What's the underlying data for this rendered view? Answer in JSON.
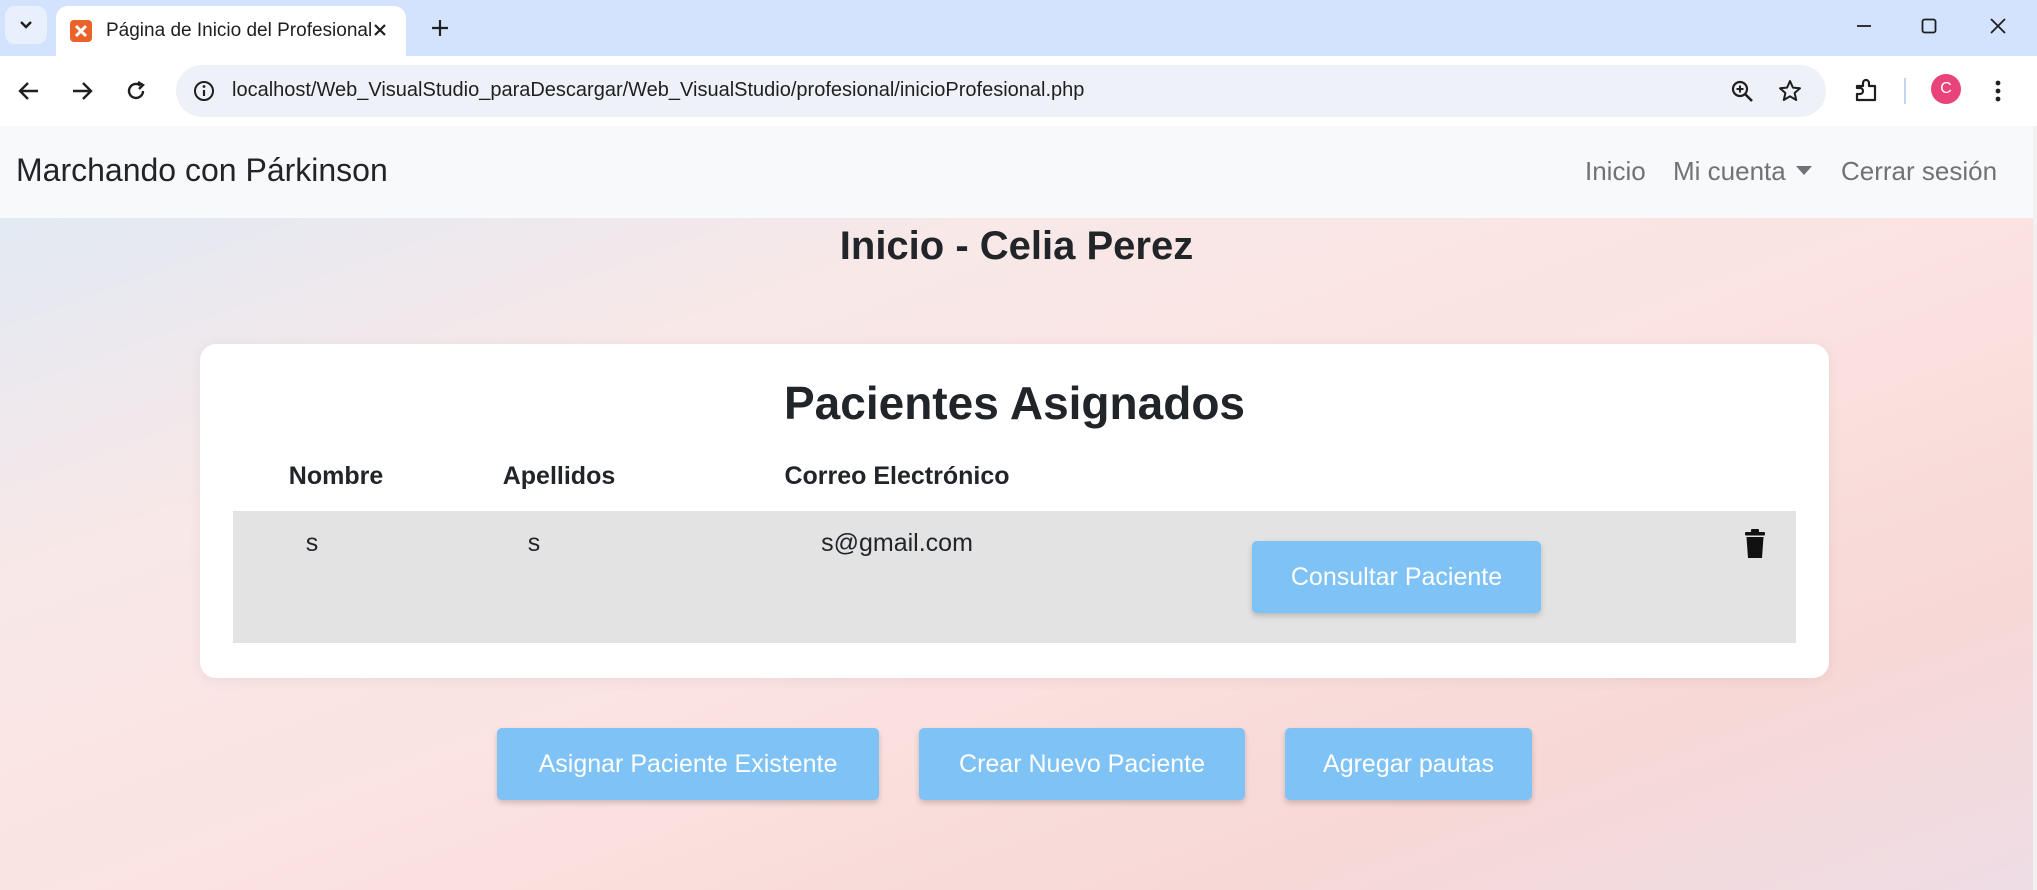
{
  "browser": {
    "tab": {
      "title": "Página de Inicio del Profesional"
    },
    "url": "localhost/Web_VisualStudio_paraDescargar/Web_VisualStudio/profesional/inicioProfesional.php",
    "profile_initial": "C",
    "icons": [
      "tab-list-icon",
      "favicon-icon",
      "close-icon",
      "plus-icon",
      "minimize-icon",
      "maximize-icon",
      "close-window-icon",
      "back-icon",
      "forward-icon",
      "reload-icon",
      "site-info-icon",
      "zoom-icon",
      "star-icon",
      "extensions-icon",
      "kebab-menu-icon"
    ]
  },
  "navbar": {
    "brand": "Marchando con Párkinson",
    "links": {
      "inicio": "Inicio",
      "mi_cuenta": "Mi cuenta",
      "cerrar_sesion": "Cerrar sesión"
    }
  },
  "page": {
    "title": "Inicio - Celia Perez"
  },
  "patients": {
    "title": "Pacientes Asignados",
    "columns": [
      "Nombre",
      "Apellidos",
      "Correo Electrónico"
    ],
    "rows": [
      {
        "nombre": "s",
        "apellidos": "s",
        "correo": "s@gmail.com",
        "action": "Consultar Paciente"
      }
    ]
  },
  "actions": {
    "assign": "Asignar Paciente Existente",
    "create": "Crear Nuevo Paciente",
    "guidelines": "Agregar pautas"
  },
  "colors": {
    "button": "#7fc2f5",
    "tabstrip": "#d3e3fd",
    "navbar": "#f8f9fa",
    "row": "#e3e3e3"
  }
}
